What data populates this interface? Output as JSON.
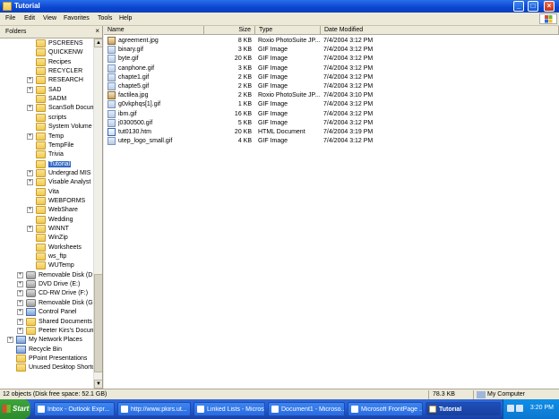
{
  "window": {
    "title": "Tutorial"
  },
  "menu": [
    "File",
    "Edit",
    "View",
    "Favorites",
    "Tools",
    "Help"
  ],
  "folders_panel": {
    "title": "Folders",
    "close": "×"
  },
  "tree": [
    {
      "label": "PSCREENS",
      "expand": "",
      "icon": "folder-icon"
    },
    {
      "label": "QUICKENW",
      "expand": "",
      "icon": "folder-icon"
    },
    {
      "label": "Recipes",
      "expand": "",
      "icon": "folder-icon"
    },
    {
      "label": "RECYCLER",
      "expand": "",
      "icon": "folder-icon"
    },
    {
      "label": "RESEARCH",
      "expand": "+",
      "icon": "folder-icon"
    },
    {
      "label": "SAD",
      "expand": "+",
      "icon": "folder-icon"
    },
    {
      "label": "SADM",
      "expand": "",
      "icon": "folder-icon"
    },
    {
      "label": "ScanSoft Docume",
      "expand": "+",
      "icon": "folder-icon"
    },
    {
      "label": "scripts",
      "expand": "",
      "icon": "folder-icon"
    },
    {
      "label": "System Volume In",
      "expand": "",
      "icon": "folder-icon"
    },
    {
      "label": "Temp",
      "expand": "+",
      "icon": "folder-icon"
    },
    {
      "label": "TempFile",
      "expand": "",
      "icon": "folder-icon"
    },
    {
      "label": "Trivia",
      "expand": "",
      "icon": "folder-icon"
    },
    {
      "label": "Tutorial",
      "expand": "",
      "icon": "folder-icon",
      "selected": true
    },
    {
      "label": "Undergrad MIS",
      "expand": "+",
      "icon": "folder-icon"
    },
    {
      "label": "Visable Analyst",
      "expand": "+",
      "icon": "folder-icon"
    },
    {
      "label": "Vita",
      "expand": "",
      "icon": "folder-icon"
    },
    {
      "label": "WEBFORMS",
      "expand": "",
      "icon": "folder-icon"
    },
    {
      "label": "WebShare",
      "expand": "+",
      "icon": "folder-icon"
    },
    {
      "label": "Wedding",
      "expand": "",
      "icon": "folder-icon"
    },
    {
      "label": "WINNT",
      "expand": "+",
      "icon": "folder-icon"
    },
    {
      "label": "WinZip",
      "expand": "",
      "icon": "folder-icon"
    },
    {
      "label": "Worksheets",
      "expand": "",
      "icon": "folder-icon"
    },
    {
      "label": "ws_ftp",
      "expand": "",
      "icon": "folder-icon"
    },
    {
      "label": "WUTemp",
      "expand": "",
      "icon": "folder-icon"
    },
    {
      "label": "Removable Disk (D:)",
      "expand": "+",
      "icon": "drive-icon",
      "level": 1
    },
    {
      "label": "DVD Drive (E:)",
      "expand": "+",
      "icon": "dvd-drive-icon",
      "level": 1
    },
    {
      "label": "CD-RW Drive (F:)",
      "expand": "+",
      "icon": "cd-drive-icon",
      "level": 1
    },
    {
      "label": "Removable Disk (G:)",
      "expand": "+",
      "icon": "drive-icon",
      "level": 1
    },
    {
      "label": "Control Panel",
      "expand": "+",
      "icon": "control-panel-icon",
      "level": 1
    },
    {
      "label": "Shared Documents",
      "expand": "+",
      "icon": "folder-icon",
      "level": 1
    },
    {
      "label": "Peeter Kirs's Documer",
      "expand": "+",
      "icon": "folder-icon",
      "level": 1
    },
    {
      "label": "My Network Places",
      "expand": "+",
      "icon": "network-icon",
      "level": 0
    },
    {
      "label": "Recycle Bin",
      "expand": "",
      "icon": "recycle-bin-icon",
      "level": 0
    },
    {
      "label": "PPoint Presentations",
      "expand": "",
      "icon": "folder-icon",
      "level": 0
    },
    {
      "label": "Unused Desktop Shortcut",
      "expand": "",
      "icon": "folder-icon",
      "level": 0
    }
  ],
  "columns": [
    "Name",
    "Size",
    "Type",
    "Date Modified"
  ],
  "files": [
    {
      "name": "agreement.jpg",
      "size": "8 KB",
      "type": "Roxio PhotoSuite JP...",
      "date": "7/4/2004 3:12 PM",
      "icon": "jpg"
    },
    {
      "name": "binary.gif",
      "size": "3 KB",
      "type": "GIF Image",
      "date": "7/4/2004 3:12 PM",
      "icon": "gif"
    },
    {
      "name": "byte.gif",
      "size": "20 KB",
      "type": "GIF Image",
      "date": "7/4/2004 3:12 PM",
      "icon": "gif"
    },
    {
      "name": "canphone.gif",
      "size": "3 KB",
      "type": "GIF Image",
      "date": "7/4/2004 3:12 PM",
      "icon": "gif"
    },
    {
      "name": "chapte1.gif",
      "size": "2 KB",
      "type": "GIF Image",
      "date": "7/4/2004 3:12 PM",
      "icon": "gif"
    },
    {
      "name": "chapte5.gif",
      "size": "2 KB",
      "type": "GIF Image",
      "date": "7/4/2004 3:12 PM",
      "icon": "gif"
    },
    {
      "name": "factilea.jpg",
      "size": "2 KB",
      "type": "Roxio PhotoSuite JP...",
      "date": "7/4/2004 3:10 PM",
      "icon": "jpg"
    },
    {
      "name": "g0vkphqs[1].gif",
      "size": "1 KB",
      "type": "GIF Image",
      "date": "7/4/2004 3:12 PM",
      "icon": "gif"
    },
    {
      "name": "ibm.gif",
      "size": "16 KB",
      "type": "GIF Image",
      "date": "7/4/2004 3:12 PM",
      "icon": "gif"
    },
    {
      "name": "j0300500.gif",
      "size": "5 KB",
      "type": "GIF Image",
      "date": "7/4/2004 3:12 PM",
      "icon": "gif"
    },
    {
      "name": "tut0130.htm",
      "size": "20 KB",
      "type": "HTML Document",
      "date": "7/4/2004 3:19 PM",
      "icon": "htm"
    },
    {
      "name": "utep_logo_small.gif",
      "size": "4 KB",
      "type": "GIF Image",
      "date": "7/4/2004 3:12 PM",
      "icon": "gif"
    }
  ],
  "status": {
    "left": "12 objects (Disk free space: 52.1 GB)",
    "size": "78.3 KB",
    "zone": "My Computer"
  },
  "taskbar": {
    "start": "Start",
    "buttons": [
      "Inbox - Outlook Expr...",
      "http://www.pkirs.ut...",
      "Linked Lists - Micros...",
      "Document1 - Microso...",
      "Microsoft FrontPage ...",
      "Tutorial"
    ],
    "clock": "3:20 PM"
  }
}
